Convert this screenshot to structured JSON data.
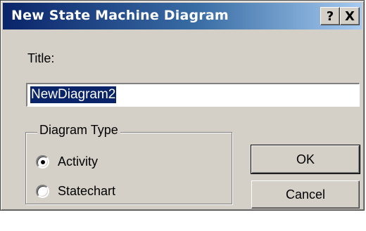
{
  "window": {
    "title": "New State Machine Diagram",
    "help_button": "?",
    "close_button": "X"
  },
  "form": {
    "title_label": "Title:",
    "title_value": "NewDiagram2"
  },
  "diagram_type": {
    "legend": "Diagram Type",
    "options": [
      {
        "label": "Activity",
        "selected": true
      },
      {
        "label": "Statechart",
        "selected": false
      }
    ]
  },
  "buttons": {
    "ok": "OK",
    "cancel": "Cancel"
  },
  "colors": {
    "titlebar_start": "#0a246a",
    "titlebar_end": "#a6caf0",
    "face": "#d4d0c8",
    "selection": "#0a246a"
  }
}
